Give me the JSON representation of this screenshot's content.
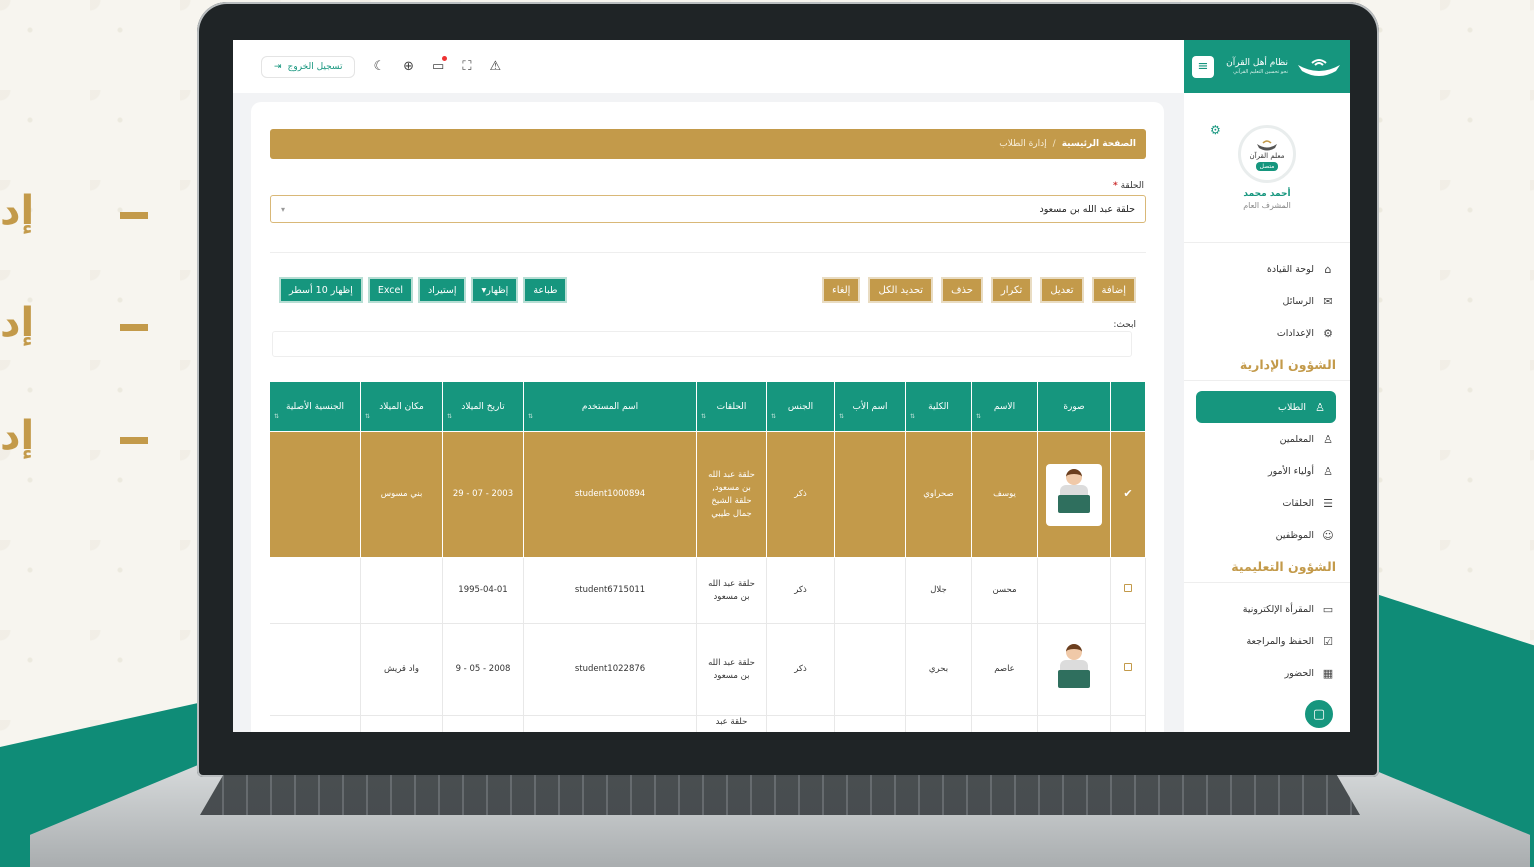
{
  "side_marketing": [
    {
      "text": "إد"
    },
    {
      "text": "إد"
    },
    {
      "text": "إد"
    }
  ],
  "brand": {
    "title": "نظام أهل القرآن",
    "subtitle": "نحو تحسين التعليم القرآني"
  },
  "profile": {
    "logo_text": "معلم القرآن",
    "badge": "متصل",
    "name": "أحمد محمد",
    "role": "المشرف العام"
  },
  "sidebar": {
    "top_items": [
      {
        "label": "لوحة القيادة",
        "icon": "home-icon",
        "glyph": "⌂"
      },
      {
        "label": "الرسائل",
        "icon": "mail-icon",
        "glyph": "✉"
      },
      {
        "label": "الإعدادات",
        "icon": "settings-icon",
        "glyph": "⚙"
      }
    ],
    "section_admin": "الشؤون الإدارية",
    "admin_items": [
      {
        "label": "الطلاب",
        "icon": "user-icon",
        "glyph": "♙",
        "active": true
      },
      {
        "label": "المعلمين",
        "icon": "user-icon",
        "glyph": "♙"
      },
      {
        "label": "أولياء الأمور",
        "icon": "user-icon",
        "glyph": "♙"
      },
      {
        "label": "الحلقات",
        "icon": "list-icon",
        "glyph": "☰"
      },
      {
        "label": "الموظفين",
        "icon": "users-icon",
        "glyph": "☺"
      }
    ],
    "section_edu": "الشؤون التعليمية",
    "edu_items": [
      {
        "label": "المقرأة الإلكترونية",
        "icon": "video-icon",
        "glyph": "▭"
      },
      {
        "label": "الحفظ والمراجعة",
        "icon": "check-square-icon",
        "glyph": "☑"
      },
      {
        "label": "الحضور",
        "icon": "calendar-icon",
        "glyph": "▦"
      }
    ]
  },
  "topbar": {
    "logout": "تسجيل الخروج"
  },
  "page": {
    "breadcrumb_home": "الصفحة الرئيسية",
    "breadcrumb_sep": "/",
    "breadcrumb_current": "إدارة الطلاب",
    "field_label": "الحلقة",
    "required_mark": "*",
    "selected_circle": "حلقة عبد الله بن مسعود",
    "search_label": "ابحث:"
  },
  "actions": {
    "right": [
      "إضافة",
      "تعديل",
      "تكرار",
      "حذف",
      "تحديد الكل",
      "إلغاء"
    ],
    "left": [
      "طباعة",
      "إظهار▾",
      "إستيراد",
      "Excel",
      "إظهار 10 أسطر"
    ]
  },
  "table": {
    "columns": [
      "",
      "صورة",
      "الاسم",
      "الكلية",
      "اسم الأب",
      "الجنس",
      "الحلقات",
      "اسم المستخدم",
      "تاريخ الميلاد",
      "مكان الميلاد",
      "الجنسية الأصلية"
    ],
    "rows": [
      {
        "selected": true,
        "check": "✔",
        "photo": true,
        "name": "يوسف",
        "college": "صحراوي",
        "father": "",
        "gender": "ذكر",
        "circles": "حلقة عبد الله بن مسعود, حلقة الشيخ جمال طيبي",
        "username": "student1000894",
        "birthdate": "2003 - 07 - 29",
        "birthplace": "بني مسوس",
        "nationality": ""
      },
      {
        "selected": false,
        "check": "",
        "photo": false,
        "name": "محسن",
        "college": "جلال",
        "father": "",
        "gender": "ذكر",
        "circles": "حلقة عبد الله بن مسعود",
        "username": "student6715011",
        "birthdate": "1995-04-01",
        "birthplace": "",
        "nationality": ""
      },
      {
        "selected": false,
        "check": "",
        "photo": true,
        "name": "عاصم",
        "college": "بحري",
        "father": "",
        "gender": "ذكر",
        "circles": "حلقة عبد الله بن مسعود",
        "username": "student1022876",
        "birthdate": "2008 - 05 - 9",
        "birthplace": "واد قريش",
        "nationality": ""
      },
      {
        "selected": false,
        "check": "",
        "photo": false,
        "name": "",
        "college": "",
        "father": "",
        "gender": "",
        "circles": "حلقة عبد",
        "username": "",
        "birthdate": "",
        "birthplace": "",
        "nationality": ""
      }
    ]
  },
  "colors": {
    "primary": "#16967e",
    "gold": "#c39a4a"
  }
}
